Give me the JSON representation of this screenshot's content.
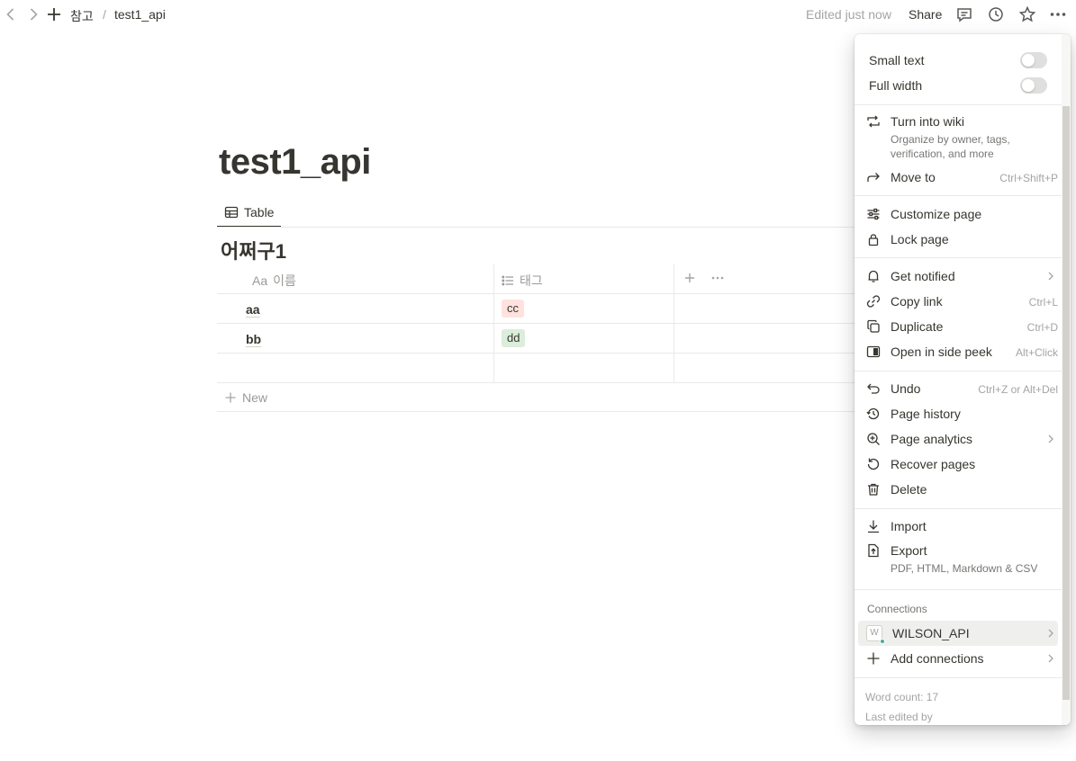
{
  "breadcrumb": {
    "parent": "참고",
    "separator": "/",
    "current": "test1_api"
  },
  "header": {
    "edited": "Edited just now",
    "share": "Share"
  },
  "page": {
    "title": "test1_api",
    "view_tab": "Table",
    "database_title": "어쩌구1",
    "columns": [
      {
        "prefix": "Aa",
        "label": "이름"
      },
      {
        "label": "태그"
      }
    ],
    "rows": [
      {
        "name": "aa",
        "tag": "cc",
        "tag_color": "#ffe2dd"
      },
      {
        "name": "bb",
        "tag": "dd",
        "tag_color": "#dbeddb"
      }
    ],
    "new_label": "New"
  },
  "menu": {
    "toggles": [
      {
        "label": "Small text",
        "on": false
      },
      {
        "label": "Full width",
        "on": false
      }
    ],
    "turn_into_wiki": {
      "label": "Turn into wiki",
      "sub": "Organize by owner, tags, verification, and more"
    },
    "move_to": {
      "label": "Move to",
      "shortcut": "Ctrl+Shift+P"
    },
    "customize": "Customize page",
    "lock": "Lock page",
    "get_notified": "Get notified",
    "copy_link": {
      "label": "Copy link",
      "shortcut": "Ctrl+L"
    },
    "duplicate": {
      "label": "Duplicate",
      "shortcut": "Ctrl+D"
    },
    "side_peek": {
      "label": "Open in side peek",
      "shortcut": "Alt+Click"
    },
    "undo": {
      "label": "Undo",
      "shortcut": "Ctrl+Z or Alt+Del"
    },
    "page_history": "Page history",
    "page_analytics": "Page analytics",
    "recover_pages": "Recover pages",
    "delete": "Delete",
    "import": "Import",
    "export": {
      "label": "Export",
      "sub": "PDF, HTML, Markdown & CSV"
    },
    "connections_label": "Connections",
    "connection": {
      "badge": "W",
      "label": "WILSON_API"
    },
    "add_connections": "Add connections",
    "word_count": "Word count: 17",
    "last_edited": "Last edited by"
  }
}
